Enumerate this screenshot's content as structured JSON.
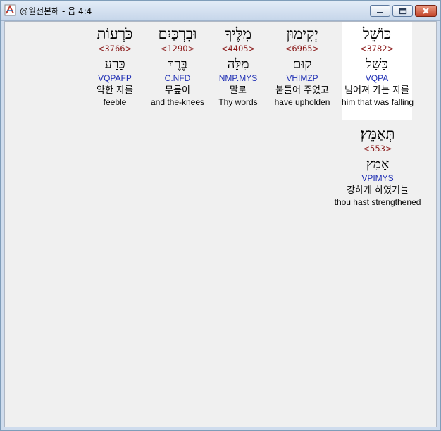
{
  "window": {
    "title": "@원전본해 - 욥 4:4",
    "controls": {
      "minimize": "minimize-icon",
      "maximize": "maximize-icon",
      "close": "close-icon"
    }
  },
  "words": [
    {
      "hebrew": "כּוֹשֵׁל",
      "strong": "<3782>",
      "lemma": "כָּשַׁל",
      "parse": "VQPA",
      "korean": "넘어져 가는 자를",
      "english": "him that was falling"
    },
    {
      "hebrew": "יְקִימוּן",
      "strong": "<6965>",
      "lemma": "קוּם",
      "parse": "VHIMZP",
      "korean": "붙들어 주었고",
      "english": "have upholden"
    },
    {
      "hebrew": "מִלֶּיךָ",
      "strong": "<4405>",
      "lemma": "מִלָּה",
      "parse": "NMP.MYS",
      "korean": "말로",
      "english": "Thy words"
    },
    {
      "hebrew": "וּבִרְכַּיִם",
      "strong": "<1290>",
      "lemma": "בֶּרֶךְ",
      "parse": "C.NFD",
      "korean": "무릎이",
      "english": "and the-knees"
    },
    {
      "hebrew": "כֹּרְעוֹת",
      "strong": "<3766>",
      "lemma": "כָּרַע",
      "parse": "VQPAFP",
      "korean": "약한 자를",
      "english": "feeble"
    },
    {
      "hebrew": "תְּאַמֵּץ׃",
      "strong": "<553>",
      "lemma": "אָמֵץ",
      "parse": "VPIMYS",
      "korean": "강하게 하였거늘",
      "english": "thou hast strengthened"
    }
  ]
}
